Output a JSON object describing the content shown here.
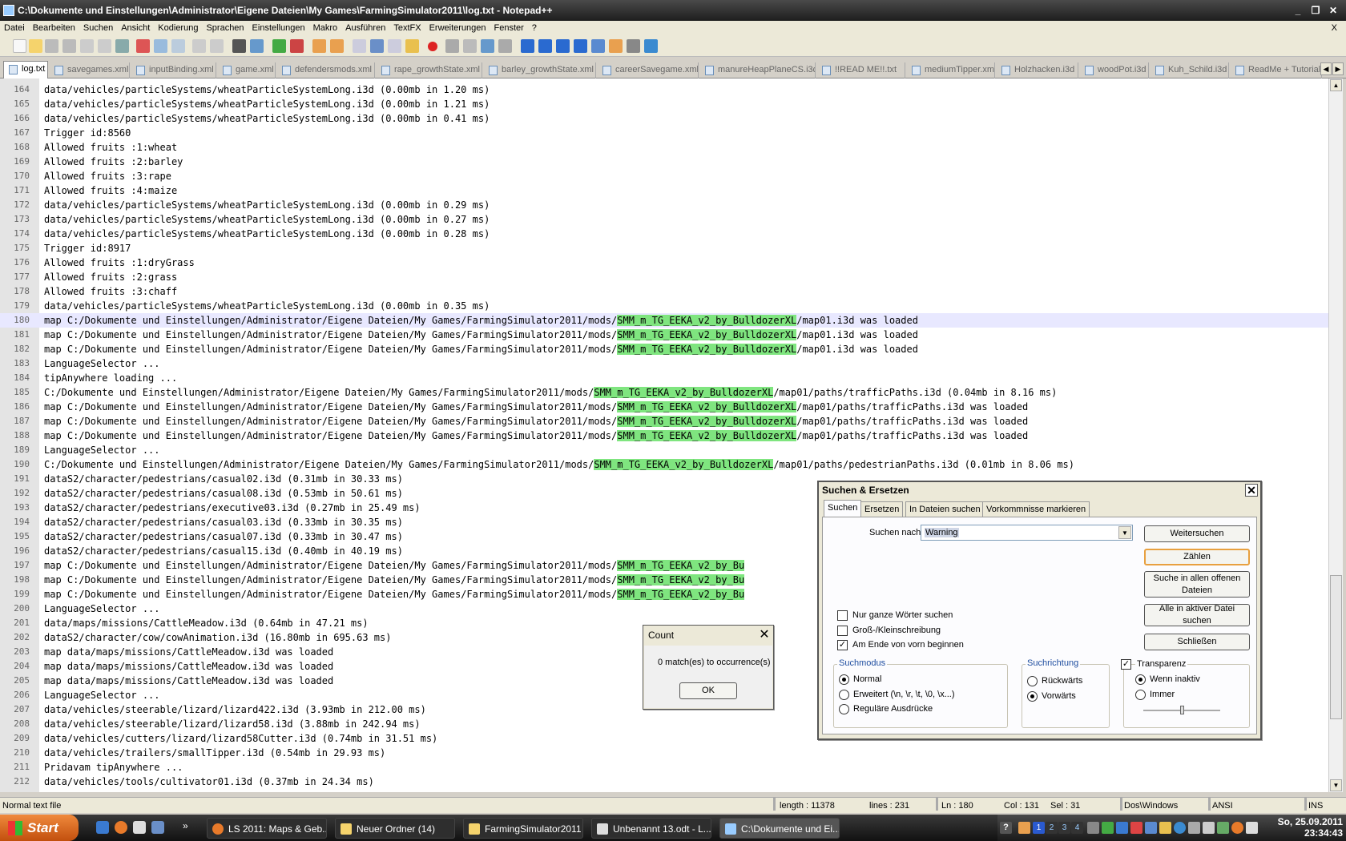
{
  "window": {
    "title": "C:\\Dokumente und Einstellungen\\Administrator\\Eigene Dateien\\My Games\\FarmingSimulator2011\\log.txt - Notepad++",
    "minimize": "_",
    "restore": "❐",
    "close": "✕"
  },
  "menu": {
    "items": [
      "Datei",
      "Bearbeiten",
      "Suchen",
      "Ansicht",
      "Kodierung",
      "Sprachen",
      "Einstellungen",
      "Makro",
      "Ausführen",
      "TextFX",
      "Erweiterungen",
      "Fenster",
      "?"
    ],
    "close": "X"
  },
  "tabs": [
    {
      "label": "log.txt"
    },
    {
      "label": "savegames.xml"
    },
    {
      "label": "inputBinding.xml"
    },
    {
      "label": "game.xml"
    },
    {
      "label": "defendersmods.xml"
    },
    {
      "label": "rape_growthState.xml"
    },
    {
      "label": "barley_growthState.xml"
    },
    {
      "label": "careerSavegame.xml"
    },
    {
      "label": "manureHeapPlaneCS.i3d"
    },
    {
      "label": "!!READ ME!!.txt"
    },
    {
      "label": "mediumTipper.xml"
    },
    {
      "label": "Holzhacken.i3d"
    },
    {
      "label": "woodPot.i3d"
    },
    {
      "label": "Kuh_Schild.i3d"
    },
    {
      "label": "ReadMe + Tutorial"
    }
  ],
  "editor": {
    "highlight": "SMM_m_TG_EEKA_v2_by_BulldozerXL",
    "current_line": 180,
    "lines": [
      {
        "n": "164",
        "t": "data/vehicles/particleSystems/wheatParticleSystemLong.i3d (0.00mb in 1.20 ms)"
      },
      {
        "n": "165",
        "t": "data/vehicles/particleSystems/wheatParticleSystemLong.i3d (0.00mb in 1.21 ms)"
      },
      {
        "n": "166",
        "t": "data/vehicles/particleSystems/wheatParticleSystemLong.i3d (0.00mb in 0.41 ms)"
      },
      {
        "n": "167",
        "t": "Trigger id:8560"
      },
      {
        "n": "168",
        "t": "Allowed fruits :1:wheat"
      },
      {
        "n": "169",
        "t": "Allowed fruits :2:barley"
      },
      {
        "n": "170",
        "t": "Allowed fruits :3:rape"
      },
      {
        "n": "171",
        "t": "Allowed fruits :4:maize"
      },
      {
        "n": "172",
        "t": "data/vehicles/particleSystems/wheatParticleSystemLong.i3d (0.00mb in 0.29 ms)"
      },
      {
        "n": "173",
        "t": "data/vehicles/particleSystems/wheatParticleSystemLong.i3d (0.00mb in 0.27 ms)"
      },
      {
        "n": "174",
        "t": "data/vehicles/particleSystems/wheatParticleSystemLong.i3d (0.00mb in 0.28 ms)"
      },
      {
        "n": "175",
        "t": "Trigger id:8917"
      },
      {
        "n": "176",
        "t": "Allowed fruits :1:dryGrass"
      },
      {
        "n": "177",
        "t": "Allowed fruits :2:grass"
      },
      {
        "n": "178",
        "t": "Allowed fruits :3:chaff"
      },
      {
        "n": "179",
        "t": "data/vehicles/particleSystems/wheatParticleSystemLong.i3d (0.00mb in 0.35 ms)"
      },
      {
        "n": "180",
        "t": "map C:/Dokumente und Einstellungen/Administrator/Eigene Dateien/My Games/FarmingSimulator2011/mods/SMM_m_TG_EEKA_v2_by_BulldozerXL/map01.i3d was loaded"
      },
      {
        "n": "181",
        "t": "map C:/Dokumente und Einstellungen/Administrator/Eigene Dateien/My Games/FarmingSimulator2011/mods/SMM_m_TG_EEKA_v2_by_BulldozerXL/map01.i3d was loaded"
      },
      {
        "n": "182",
        "t": "map C:/Dokumente und Einstellungen/Administrator/Eigene Dateien/My Games/FarmingSimulator2011/mods/SMM_m_TG_EEKA_v2_by_BulldozerXL/map01.i3d was loaded"
      },
      {
        "n": "183",
        "t": "LanguageSelector ..."
      },
      {
        "n": "184",
        "t": "tipAnywhere loading ..."
      },
      {
        "n": "185",
        "t": "C:/Dokumente und Einstellungen/Administrator/Eigene Dateien/My Games/FarmingSimulator2011/mods/SMM_m_TG_EEKA_v2_by_BulldozerXL/map01/paths/trafficPaths.i3d (0.04mb in 8.16 ms)"
      },
      {
        "n": "186",
        "t": "map C:/Dokumente und Einstellungen/Administrator/Eigene Dateien/My Games/FarmingSimulator2011/mods/SMM_m_TG_EEKA_v2_by_BulldozerXL/map01/paths/trafficPaths.i3d was loaded"
      },
      {
        "n": "187",
        "t": "map C:/Dokumente und Einstellungen/Administrator/Eigene Dateien/My Games/FarmingSimulator2011/mods/SMM_m_TG_EEKA_v2_by_BulldozerXL/map01/paths/trafficPaths.i3d was loaded"
      },
      {
        "n": "188",
        "t": "map C:/Dokumente und Einstellungen/Administrator/Eigene Dateien/My Games/FarmingSimulator2011/mods/SMM_m_TG_EEKA_v2_by_BulldozerXL/map01/paths/trafficPaths.i3d was loaded"
      },
      {
        "n": "189",
        "t": "LanguageSelector ..."
      },
      {
        "n": "190",
        "t": "C:/Dokumente und Einstellungen/Administrator/Eigene Dateien/My Games/FarmingSimulator2011/mods/SMM_m_TG_EEKA_v2_by_BulldozerXL/map01/paths/pedestrianPaths.i3d (0.01mb in 8.06 ms)"
      },
      {
        "n": "191",
        "t": "dataS2/character/pedestrians/casual02.i3d (0.31mb in 30.33 ms)"
      },
      {
        "n": "192",
        "t": "dataS2/character/pedestrians/casual08.i3d (0.53mb in 50.61 ms)"
      },
      {
        "n": "193",
        "t": "dataS2/character/pedestrians/executive03.i3d (0.27mb in 25.49 ms)"
      },
      {
        "n": "194",
        "t": "dataS2/character/pedestrians/casual03.i3d (0.33mb in 30.35 ms)"
      },
      {
        "n": "195",
        "t": "dataS2/character/pedestrians/casual07.i3d (0.33mb in 30.47 ms)"
      },
      {
        "n": "196",
        "t": "dataS2/character/pedestrians/casual15.i3d (0.40mb in 40.19 ms)"
      },
      {
        "n": "197",
        "t": "map C:/Dokumente und Einstellungen/Administrator/Eigene Dateien/My Games/FarmingSimulator2011/mods/SMM_m_TG_EEKA_v2_by_Bu"
      },
      {
        "n": "198",
        "t": "map C:/Dokumente und Einstellungen/Administrator/Eigene Dateien/My Games/FarmingSimulator2011/mods/SMM_m_TG_EEKA_v2_by_Bu"
      },
      {
        "n": "199",
        "t": "map C:/Dokumente und Einstellungen/Administrator/Eigene Dateien/My Games/FarmingSimulator2011/mods/SMM_m_TG_EEKA_v2_by_Bu"
      },
      {
        "n": "200",
        "t": "LanguageSelector ..."
      },
      {
        "n": "201",
        "t": "data/maps/missions/CattleMeadow.i3d (0.64mb in 47.21 ms)"
      },
      {
        "n": "202",
        "t": "dataS2/character/cow/cowAnimation.i3d (16.80mb in 695.63 ms)"
      },
      {
        "n": "203",
        "t": "map data/maps/missions/CattleMeadow.i3d was loaded"
      },
      {
        "n": "204",
        "t": "map data/maps/missions/CattleMeadow.i3d was loaded"
      },
      {
        "n": "205",
        "t": "map data/maps/missions/CattleMeadow.i3d was loaded"
      },
      {
        "n": "206",
        "t": "LanguageSelector ..."
      },
      {
        "n": "207",
        "t": "data/vehicles/steerable/lizard/lizard422.i3d (3.93mb in 212.00 ms)"
      },
      {
        "n": "208",
        "t": "data/vehicles/steerable/lizard/lizard58.i3d (3.88mb in 242.94 ms)"
      },
      {
        "n": "209",
        "t": "data/vehicles/cutters/lizard/lizard58Cutter.i3d (0.74mb in 31.51 ms)"
      },
      {
        "n": "210",
        "t": "data/vehicles/trailers/smallTipper.i3d (0.54mb in 29.93 ms)"
      },
      {
        "n": "211",
        "t": "Pridavam tipAnywhere ..."
      },
      {
        "n": "212",
        "t": "data/vehicles/tools/cultivator01.i3d (0.37mb in 24.34 ms)"
      }
    ]
  },
  "status": {
    "filetype": "Normal text file",
    "length": "length : 11378",
    "lines": "lines : 231",
    "ln": "Ln : 180",
    "col": "Col : 131",
    "sel": "Sel : 31",
    "eol": "Dos\\Windows",
    "encoding": "ANSI",
    "mode": "INS"
  },
  "find_dialog": {
    "title": "Suchen & Ersetzen",
    "close": "✕",
    "tabs": [
      "Suchen",
      "Ersetzen",
      "In Dateien suchen",
      "Vorkommnisse markieren"
    ],
    "search_label": "Suchen nach",
    "search_value": "Warning",
    "buttons": {
      "find_next": "Weitersuchen",
      "count": "Zählen",
      "find_all_open": "Suche in allen offenen Dateien",
      "find_all_current": "Alle in aktiver Datei suchen",
      "close": "Schließen"
    },
    "options": {
      "whole_word": "Nur ganze Wörter suchen",
      "match_case": "Groß-/Kleinschreibung",
      "wrap": "Am Ende von vorn beginnen"
    },
    "search_mode": {
      "title": "Suchmodus",
      "normal": "Normal",
      "extended": "Erweitert (\\n, \\r, \\t, \\0, \\x...)",
      "regex": "Reguläre Ausdrücke"
    },
    "direction": {
      "title": "Suchrichtung",
      "up": "Rückwärts",
      "down": "Vorwärts"
    },
    "transparency": {
      "title": "Transparenz",
      "on_lose_focus": "Wenn inaktiv",
      "always": "Immer"
    }
  },
  "count_dialog": {
    "title": "Count",
    "close": "✕",
    "message": "0 match(es) to occurrence(s)",
    "ok": "OK"
  },
  "taskbar": {
    "start": "Start",
    "more": "»",
    "tasks": [
      {
        "label": "LS 2011: Maps & Geb..."
      },
      {
        "label": "Neuer Ordner (14)"
      },
      {
        "label": "FarmingSimulator2011"
      },
      {
        "label": "Unbenannt 13.odt - L..."
      },
      {
        "label": "C:\\Dokumente und Ei..."
      }
    ],
    "clock_date": "So, 25.09.2011",
    "clock_time": "23:34:43",
    "tray_help": "?",
    "tray_digits": [
      "1",
      "2",
      "3",
      "4"
    ]
  }
}
